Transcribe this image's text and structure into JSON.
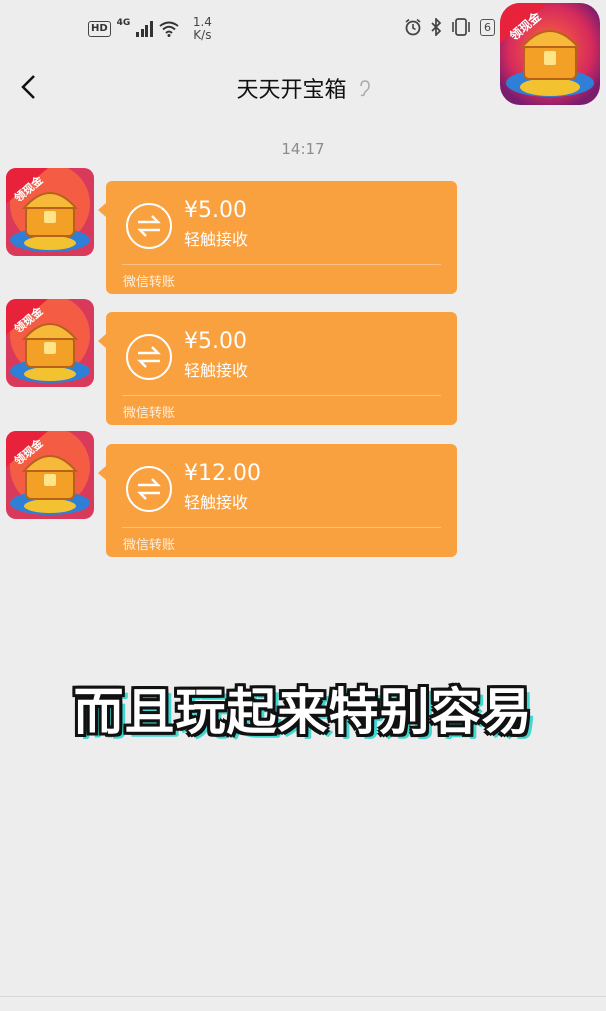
{
  "status_bar": {
    "hd": "HD",
    "network": "4G",
    "speed_value": "1.4",
    "speed_unit": "K/s",
    "battery": "6",
    "icons": [
      "alarm-icon",
      "bluetooth-icon",
      "vibrate-icon"
    ]
  },
  "nav": {
    "title": "天天开宝箱",
    "back_icon": "chevron-left-icon",
    "title_icon": "ear-icon"
  },
  "chat": {
    "timestamp": "14:17",
    "messages": [
      {
        "amount": "¥5.00",
        "action": "轻触接收",
        "footer": "微信转账"
      },
      {
        "amount": "¥5.00",
        "action": "轻触接收",
        "footer": "微信转账"
      },
      {
        "amount": "¥12.00",
        "action": "轻触接收",
        "footer": "微信转账"
      }
    ]
  },
  "avatar_badge": "领现金",
  "caption": "而且玩起来特别容易",
  "colors": {
    "bubble": "#f9a03f",
    "background": "#ededed",
    "caption_shadow": "#41d8d0"
  }
}
